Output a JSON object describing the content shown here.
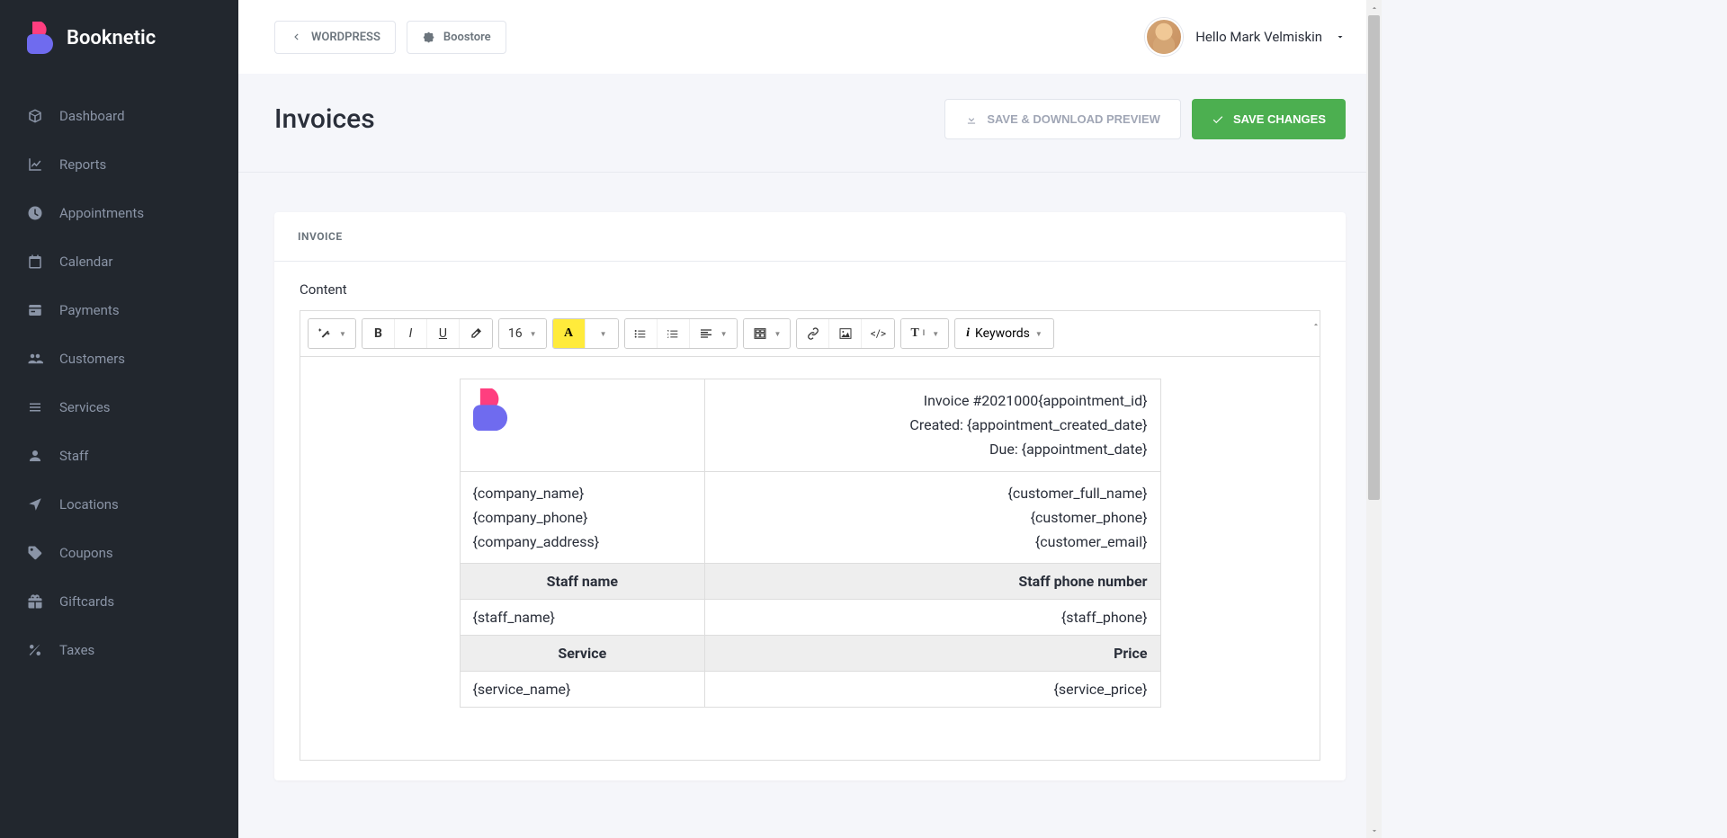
{
  "brand": "Booknetic",
  "sidebar": {
    "items": [
      {
        "label": "Dashboard",
        "icon": "dashboard"
      },
      {
        "label": "Reports",
        "icon": "chart"
      },
      {
        "label": "Appointments",
        "icon": "clock"
      },
      {
        "label": "Calendar",
        "icon": "calendar"
      },
      {
        "label": "Payments",
        "icon": "wallet"
      },
      {
        "label": "Customers",
        "icon": "users"
      },
      {
        "label": "Services",
        "icon": "list"
      },
      {
        "label": "Staff",
        "icon": "user"
      },
      {
        "label": "Locations",
        "icon": "location"
      },
      {
        "label": "Coupons",
        "icon": "tag"
      },
      {
        "label": "Giftcards",
        "icon": "gift"
      },
      {
        "label": "Taxes",
        "icon": "percent"
      }
    ]
  },
  "breadcrumbs": [
    {
      "label": "WORDPRESS",
      "icon": "chevron-left"
    },
    {
      "label": "Boostore",
      "icon": "puzzle"
    }
  ],
  "user_greeting": "Hello Mark Velmiskin",
  "page": {
    "title": "Invoices",
    "secondary_action": "SAVE & DOWNLOAD PREVIEW",
    "primary_action": "SAVE CHANGES"
  },
  "panel": {
    "tab": "INVOICE",
    "content_label": "Content"
  },
  "toolbar": {
    "font_size": "16",
    "keywords_label": "Keywords"
  },
  "invoice": {
    "meta": {
      "line1": "Invoice #2021000{appointment_id}",
      "line2": "Created: {appointment_created_date}",
      "line3": "Due: {appointment_date}"
    },
    "company": {
      "name": "{company_name}",
      "phone": "{company_phone}",
      "address": "{company_address}"
    },
    "customer": {
      "name": "{customer_full_name}",
      "phone": "{customer_phone}",
      "email": "{customer_email}"
    },
    "staff_header_left": "Staff name",
    "staff_header_right": "Staff phone number",
    "staff_name": "{staff_name}",
    "staff_phone": "{staff_phone}",
    "service_header_left": "Service",
    "service_header_right": "Price",
    "service_name": "{service_name}",
    "service_price": "{service_price}"
  }
}
